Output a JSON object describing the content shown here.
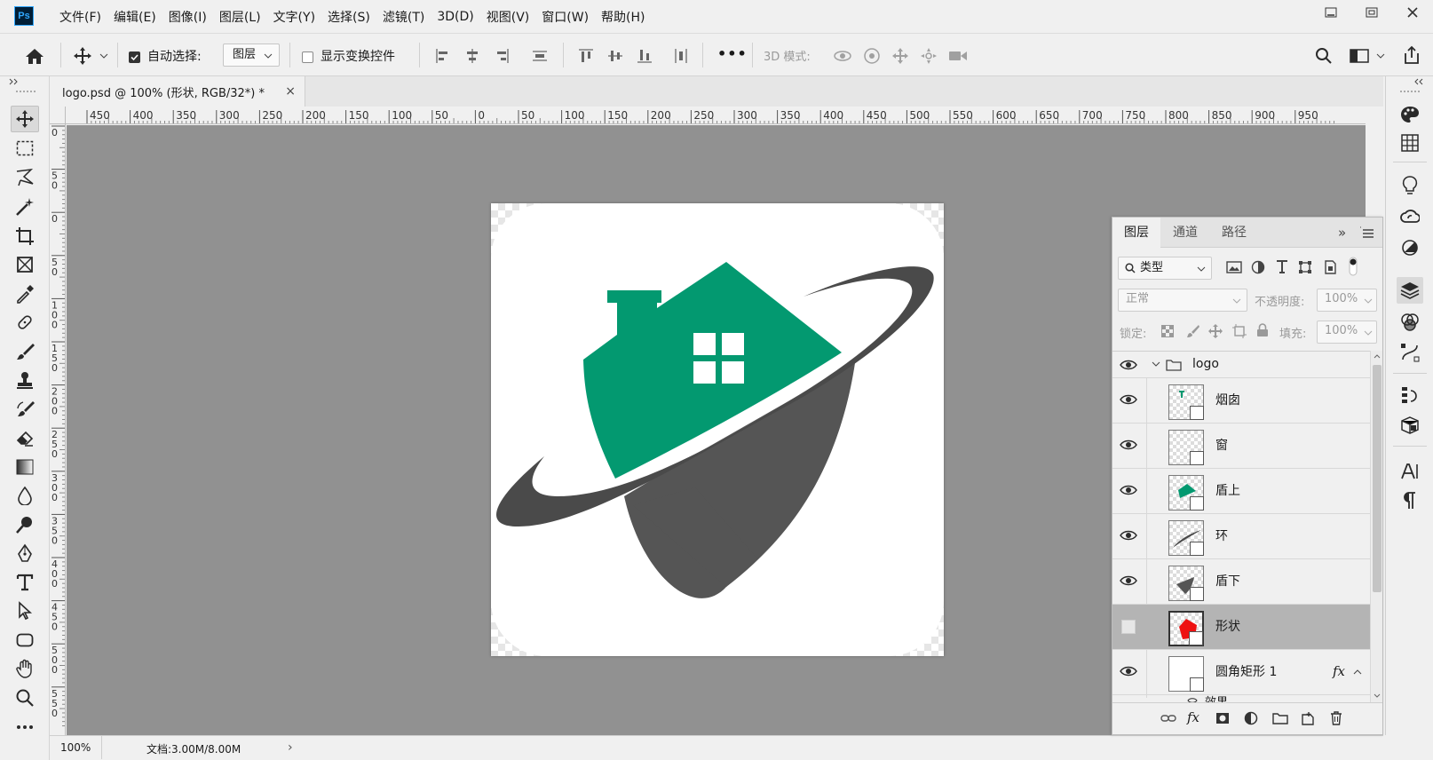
{
  "app": {
    "logo_text": "Ps"
  },
  "menu": [
    "文件(F)",
    "编辑(E)",
    "图像(I)",
    "图层(L)",
    "文字(Y)",
    "选择(S)",
    "滤镜(T)",
    "3D(D)",
    "视图(V)",
    "窗口(W)",
    "帮助(H)"
  ],
  "options_bar": {
    "auto_select_label": "自动选择:",
    "auto_select_checked": true,
    "auto_select_target": "图层",
    "show_transform_label": "显示变换控件",
    "show_transform_checked": false,
    "more_label": "•••",
    "mode_3d_label": "3D 模式:"
  },
  "document": {
    "tab_title": "logo.psd @ 100% (形状, RGB/32*) *",
    "close_glyph": "×",
    "zoom": "100%",
    "doc_info": "文档:3.00M/8.00M",
    "status_arrow": "›"
  },
  "ruler": {
    "h_labels": [
      "450",
      "400",
      "350",
      "300",
      "250",
      "200",
      "150",
      "100",
      "50",
      "0",
      "50",
      "100",
      "150",
      "200",
      "250",
      "300",
      "350",
      "400",
      "450",
      "500",
      "550",
      "600",
      "650",
      "700",
      "750",
      "800",
      "850",
      "900",
      "950"
    ],
    "v_labels": [
      "0",
      "5 0",
      "0",
      "5 0",
      "1 0 0",
      "1 5 0",
      "2 0 0",
      "2 5 0",
      "3 0 0",
      "3 5 0",
      "4 0 0",
      "4 5 0",
      "5 0 0",
      "5 5 0"
    ]
  },
  "colors": {
    "house_green": "#039970",
    "shield_gray": "#555555",
    "ring_gray": "#4a4a4a",
    "canvas_bg": "#919191",
    "selected_row": "#b4b4b4"
  },
  "layers_panel": {
    "tabs": [
      "图层",
      "通道",
      "路径"
    ],
    "active_tab": 0,
    "filter_kind": "类型",
    "blend_mode": "正常",
    "opacity_label": "不透明度:",
    "opacity_value": "100%",
    "lock_label": "锁定:",
    "fill_label": "填充:",
    "fill_value": "100%",
    "group_name": "logo",
    "layers": [
      {
        "name": "烟囱",
        "visible": true,
        "selected": false
      },
      {
        "name": "窗",
        "visible": true,
        "selected": false
      },
      {
        "name": "盾上",
        "visible": true,
        "selected": false
      },
      {
        "name": "环",
        "visible": true,
        "selected": false
      },
      {
        "name": "盾下",
        "visible": true,
        "selected": false
      },
      {
        "name": "形状",
        "visible": false,
        "selected": true
      },
      {
        "name": "圆角矩形 1",
        "visible": true,
        "selected": false,
        "fx": true
      }
    ],
    "effect_label": "效果",
    "fx_glyph": "fx",
    "panel_menu_glyph": "»"
  }
}
